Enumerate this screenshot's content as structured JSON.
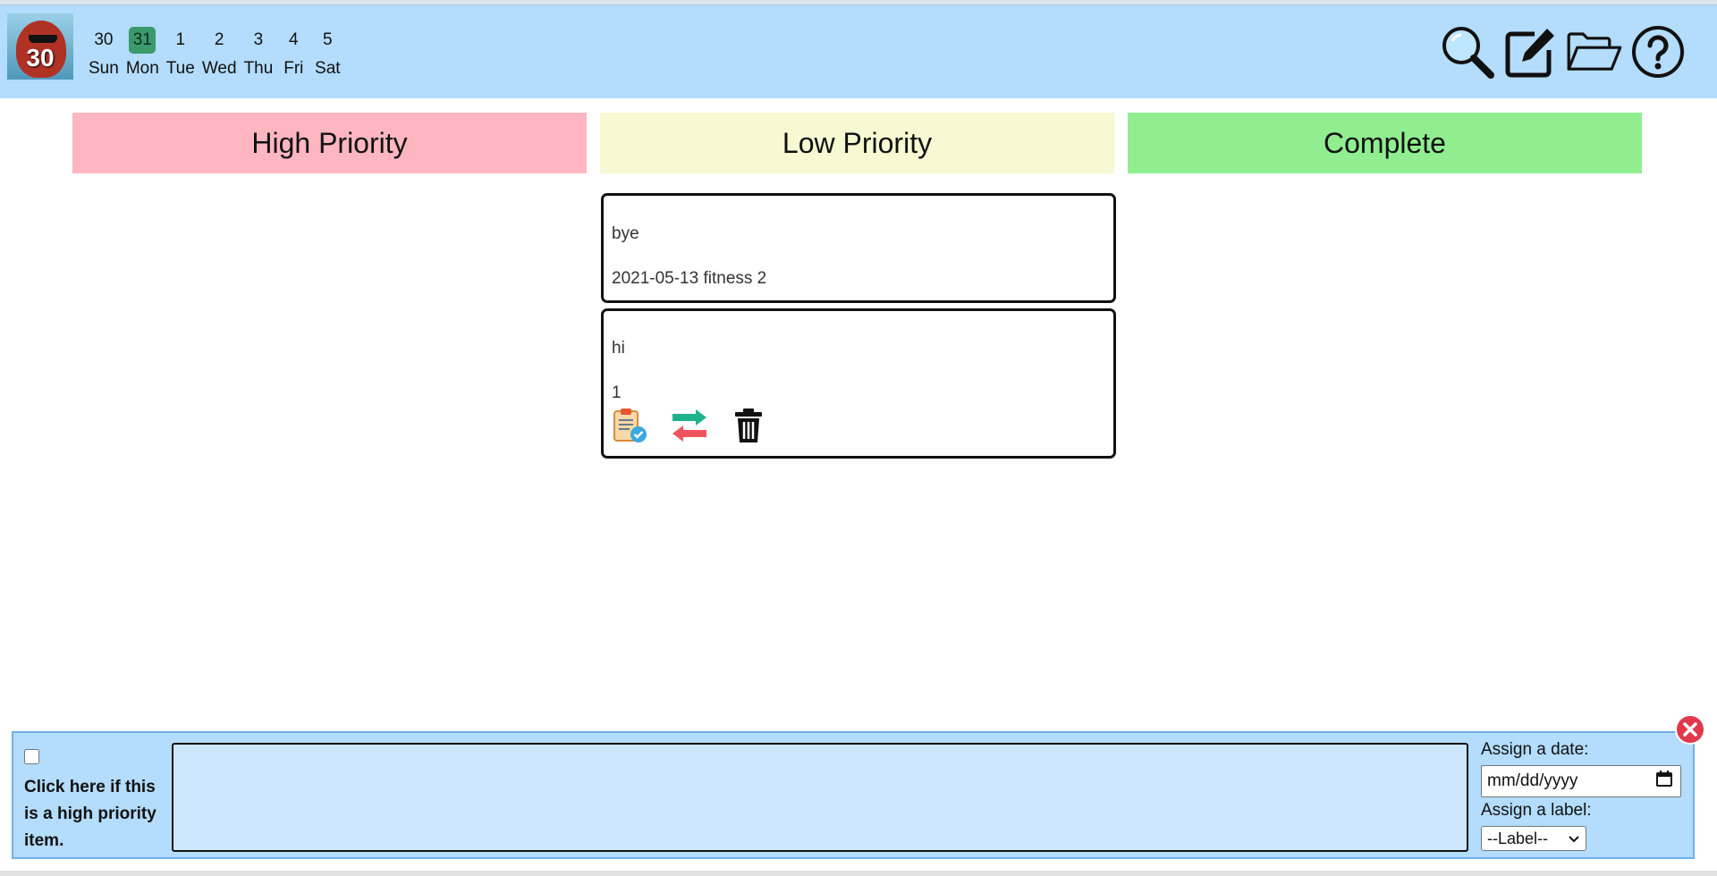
{
  "app": {
    "logo_text": "30"
  },
  "week": {
    "days": [
      {
        "num": "30",
        "name": "Sun",
        "active": false
      },
      {
        "num": "31",
        "name": "Mon",
        "active": true
      },
      {
        "num": "1",
        "name": "Tue",
        "active": false
      },
      {
        "num": "2",
        "name": "Wed",
        "active": false
      },
      {
        "num": "3",
        "name": "Thu",
        "active": false
      },
      {
        "num": "4",
        "name": "Fri",
        "active": false
      },
      {
        "num": "5",
        "name": "Sat",
        "active": false
      }
    ]
  },
  "toolbar": {
    "icons": [
      "search-icon",
      "edit-icon",
      "folder-icon",
      "help-icon"
    ]
  },
  "columns": {
    "high": "High Priority",
    "low": "Low Priority",
    "complete": "Complete",
    "colors": {
      "high": "#ffb6c1",
      "low": "#f8f8d2",
      "complete": "#90ee90"
    }
  },
  "cards": [
    {
      "title": "bye",
      "meta": "2021-05-13 fitness 2"
    },
    {
      "title": "hi",
      "meta": "1",
      "actions": [
        "clipboard-check-icon",
        "swap-arrows-icon",
        "trash-icon"
      ]
    }
  ],
  "entry": {
    "high_priority_label": "Click here if this is a high priority item.",
    "date_label": "Assign a date:",
    "date_placeholder": "mm/dd/yyyy",
    "label_label": "Assign a label:",
    "label_selected": "--Label--"
  },
  "colors": {
    "topbar": "#b3dcfd",
    "active_day": "#3a9a6c",
    "close": "#e0394b"
  }
}
